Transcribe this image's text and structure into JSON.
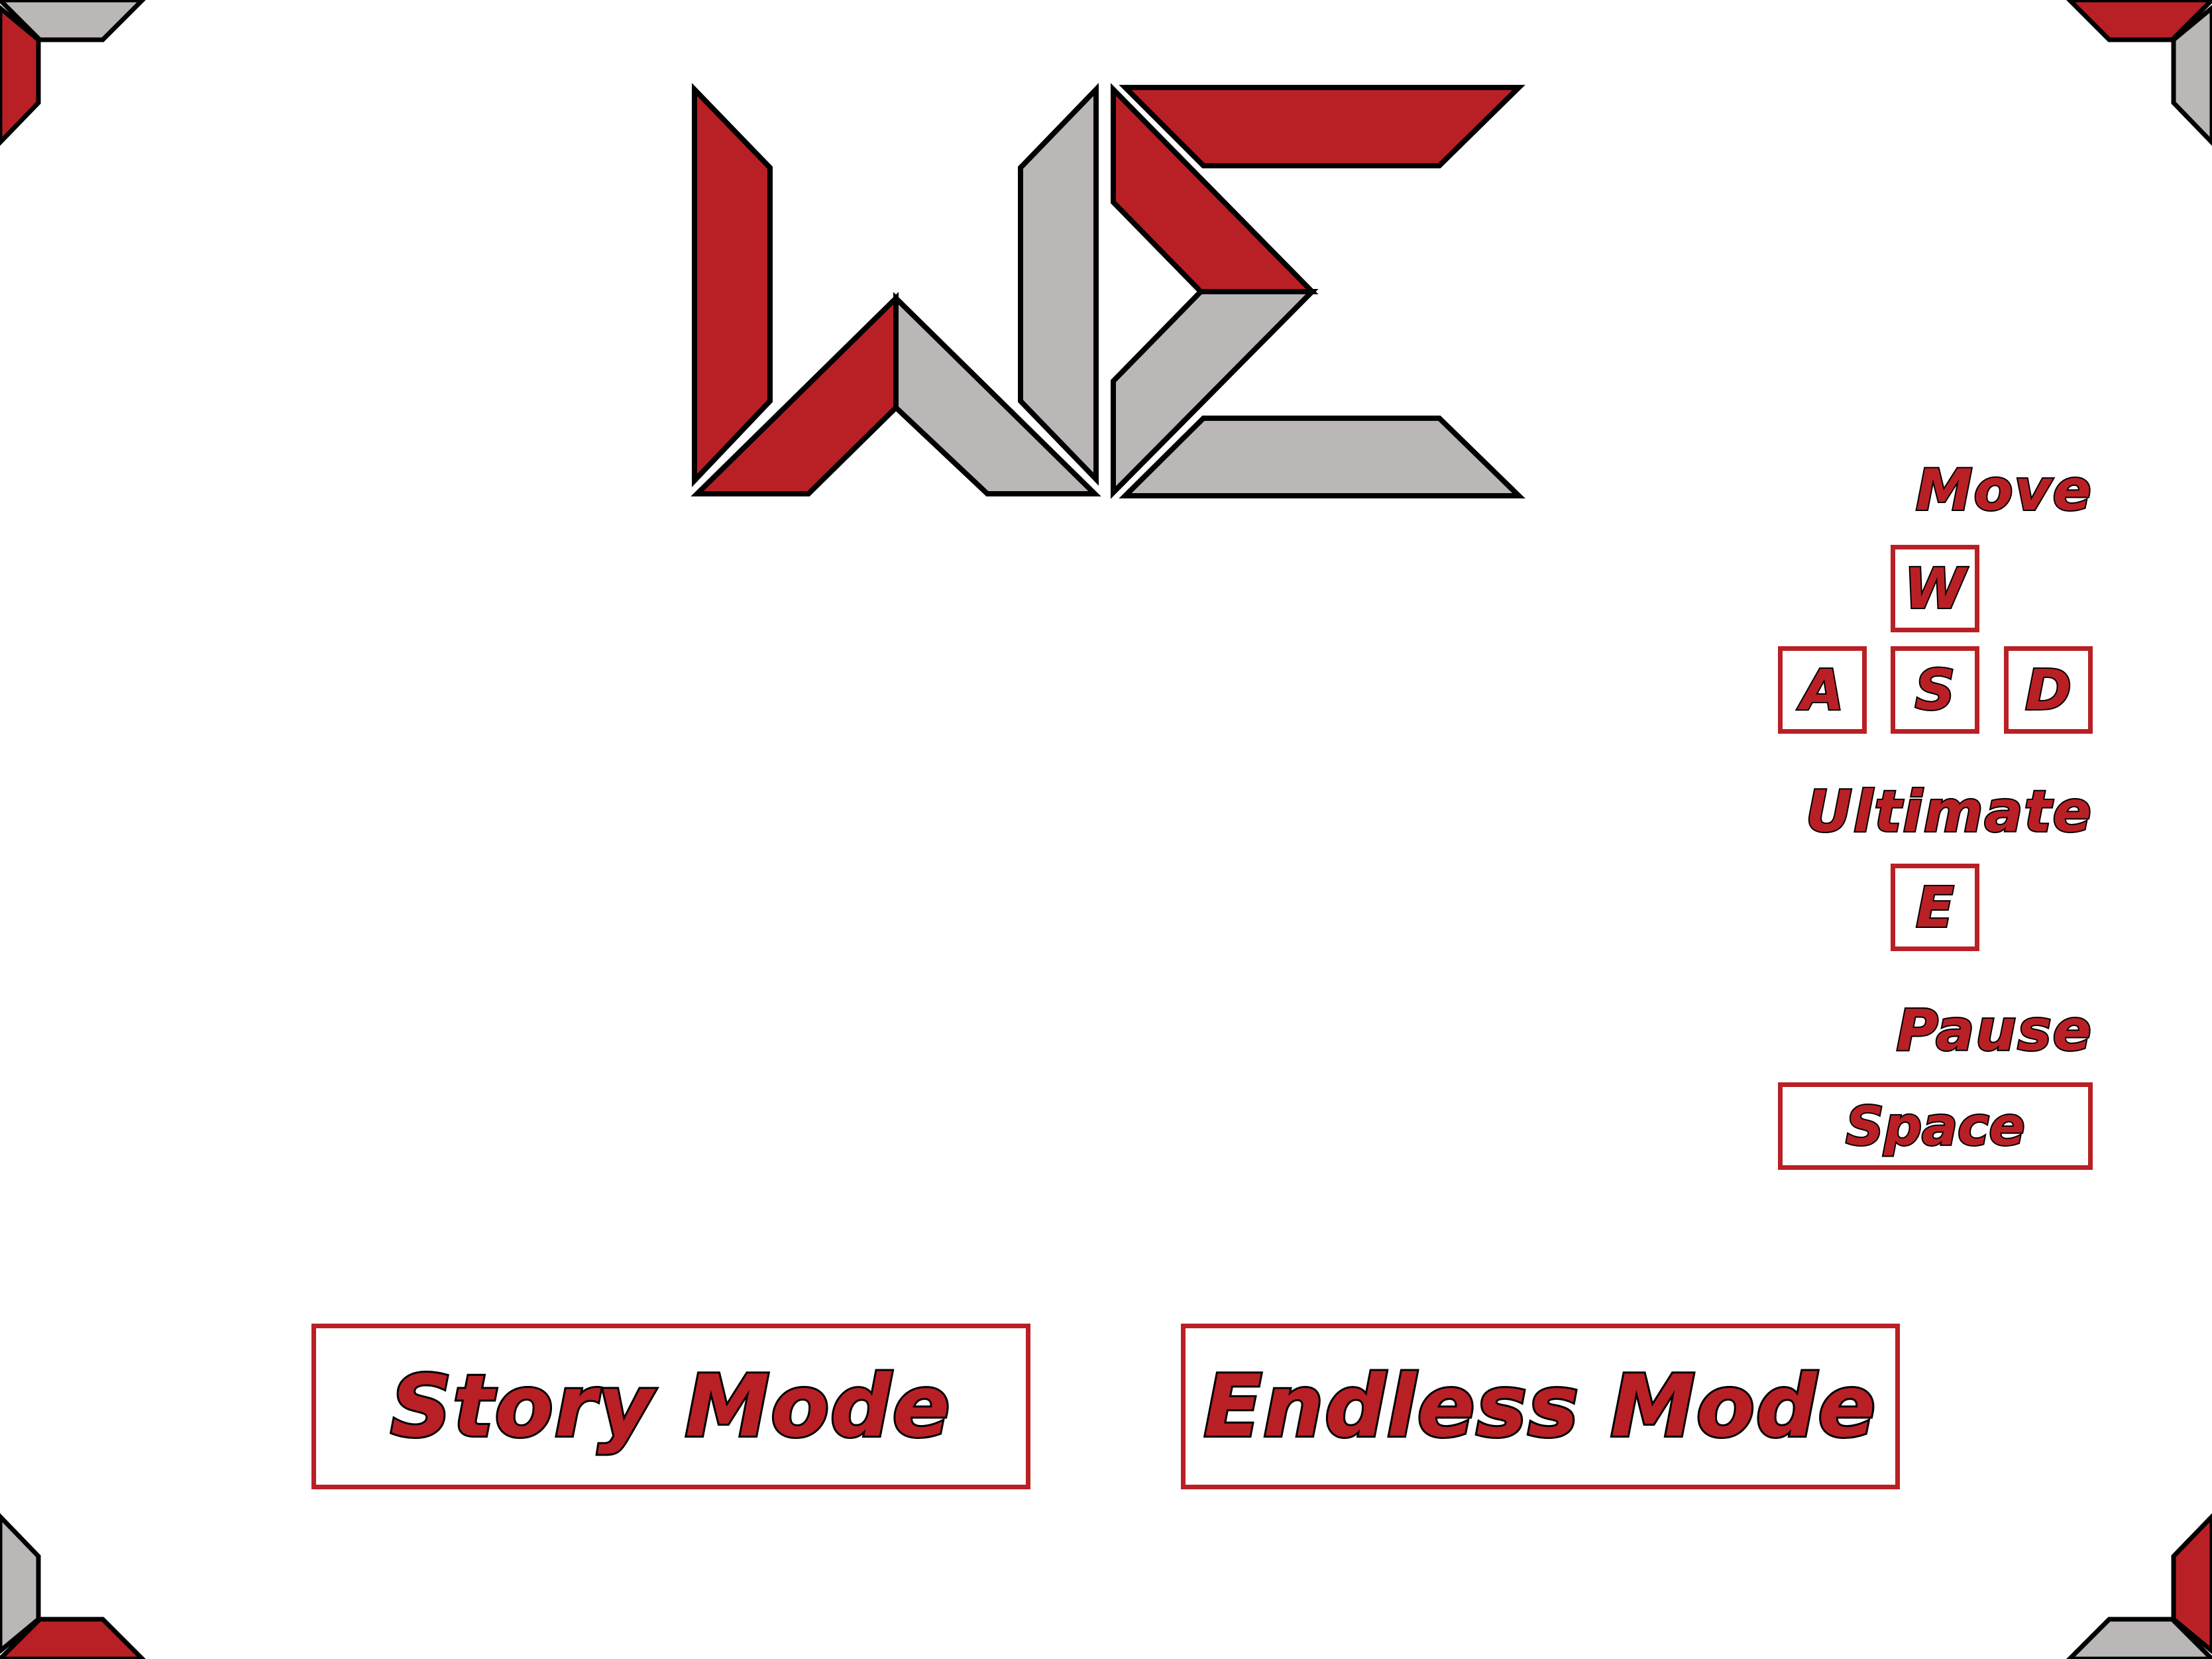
{
  "logo": {
    "icon": "we-monogram-logo",
    "colors": {
      "red": "#b92025",
      "gray": "#bab7b6",
      "outline": "#000000"
    }
  },
  "controls": {
    "move_label": "Move",
    "keys_move": {
      "up": "W",
      "left": "A",
      "down": "S",
      "right": "D"
    },
    "ultimate_label": "Ultimate",
    "ultimate_key": "E",
    "pause_label": "Pause",
    "pause_key": "Space"
  },
  "menu": {
    "story_mode": "Story Mode",
    "endless_mode": "Endless Mode"
  },
  "decor": {
    "corner_icon": "corner-bracket-icon"
  },
  "colors": {
    "accent": "#b92025",
    "secondary": "#bab7b6",
    "background": "#ffffff"
  }
}
